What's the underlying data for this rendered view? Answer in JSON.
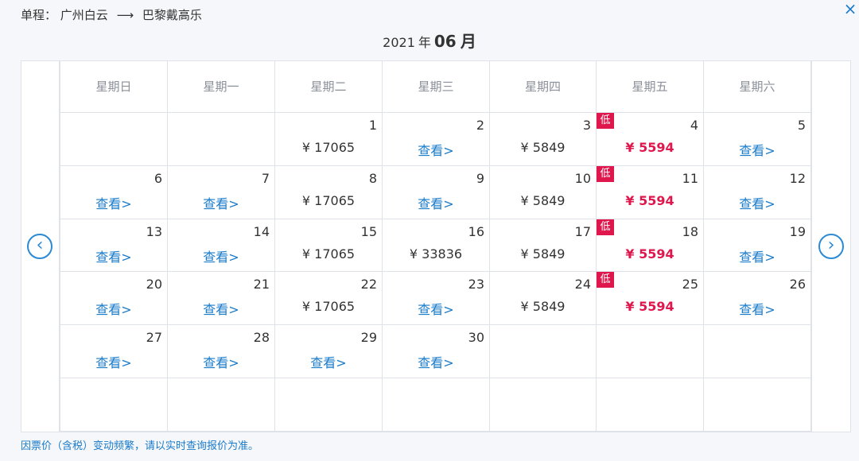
{
  "header": {
    "trip_type": "单程：",
    "origin": "广州白云",
    "arrow": "⟶",
    "destination": "巴黎戴高乐",
    "close_icon": "×"
  },
  "month": {
    "year": "2021",
    "year_unit": "年",
    "month": "06",
    "month_unit": "月"
  },
  "nav": {
    "prev_icon": "‹",
    "next_icon": "›"
  },
  "weekdays": [
    "星期日",
    "星期一",
    "星期二",
    "星期三",
    "星期四",
    "星期五",
    "星期六"
  ],
  "weeks": [
    [
      null,
      null,
      {
        "day": "1",
        "type": "price",
        "text": "¥ 17065"
      },
      {
        "day": "2",
        "type": "view",
        "text": "查看>"
      },
      {
        "day": "3",
        "type": "price",
        "text": "¥ 5849"
      },
      {
        "day": "4",
        "type": "low",
        "text": "¥ 5594",
        "tag": "低"
      },
      {
        "day": "5",
        "type": "view",
        "text": "查看>"
      }
    ],
    [
      {
        "day": "6",
        "type": "view",
        "text": "查看>"
      },
      {
        "day": "7",
        "type": "view",
        "text": "查看>"
      },
      {
        "day": "8",
        "type": "price",
        "text": "¥ 17065"
      },
      {
        "day": "9",
        "type": "view",
        "text": "查看>"
      },
      {
        "day": "10",
        "type": "price",
        "text": "¥ 5849"
      },
      {
        "day": "11",
        "type": "low",
        "text": "¥ 5594",
        "tag": "低"
      },
      {
        "day": "12",
        "type": "view",
        "text": "查看>"
      }
    ],
    [
      {
        "day": "13",
        "type": "view",
        "text": "查看>"
      },
      {
        "day": "14",
        "type": "view",
        "text": "查看>"
      },
      {
        "day": "15",
        "type": "price",
        "text": "¥ 17065"
      },
      {
        "day": "16",
        "type": "price",
        "text": "¥ 33836"
      },
      {
        "day": "17",
        "type": "price",
        "text": "¥ 5849"
      },
      {
        "day": "18",
        "type": "low",
        "text": "¥ 5594",
        "tag": "低"
      },
      {
        "day": "19",
        "type": "view",
        "text": "查看>"
      }
    ],
    [
      {
        "day": "20",
        "type": "view",
        "text": "查看>"
      },
      {
        "day": "21",
        "type": "view",
        "text": "查看>"
      },
      {
        "day": "22",
        "type": "price",
        "text": "¥ 17065"
      },
      {
        "day": "23",
        "type": "view",
        "text": "查看>"
      },
      {
        "day": "24",
        "type": "price",
        "text": "¥ 5849"
      },
      {
        "day": "25",
        "type": "low",
        "text": "¥ 5594",
        "tag": "低"
      },
      {
        "day": "26",
        "type": "view",
        "text": "查看>"
      }
    ],
    [
      {
        "day": "27",
        "type": "view",
        "text": "查看>"
      },
      {
        "day": "28",
        "type": "view",
        "text": "查看>"
      },
      {
        "day": "29",
        "type": "view",
        "text": "查看>"
      },
      {
        "day": "30",
        "type": "view",
        "text": "查看>"
      },
      null,
      null,
      null
    ],
    [
      null,
      null,
      null,
      null,
      null,
      null,
      null
    ]
  ],
  "footnote": "因票价（含税）变动频繁，请以实时查询报价为准。",
  "colors": {
    "accent": "#1a7bc9",
    "low_price": "#e0174d",
    "border": "#dfe2e8"
  }
}
